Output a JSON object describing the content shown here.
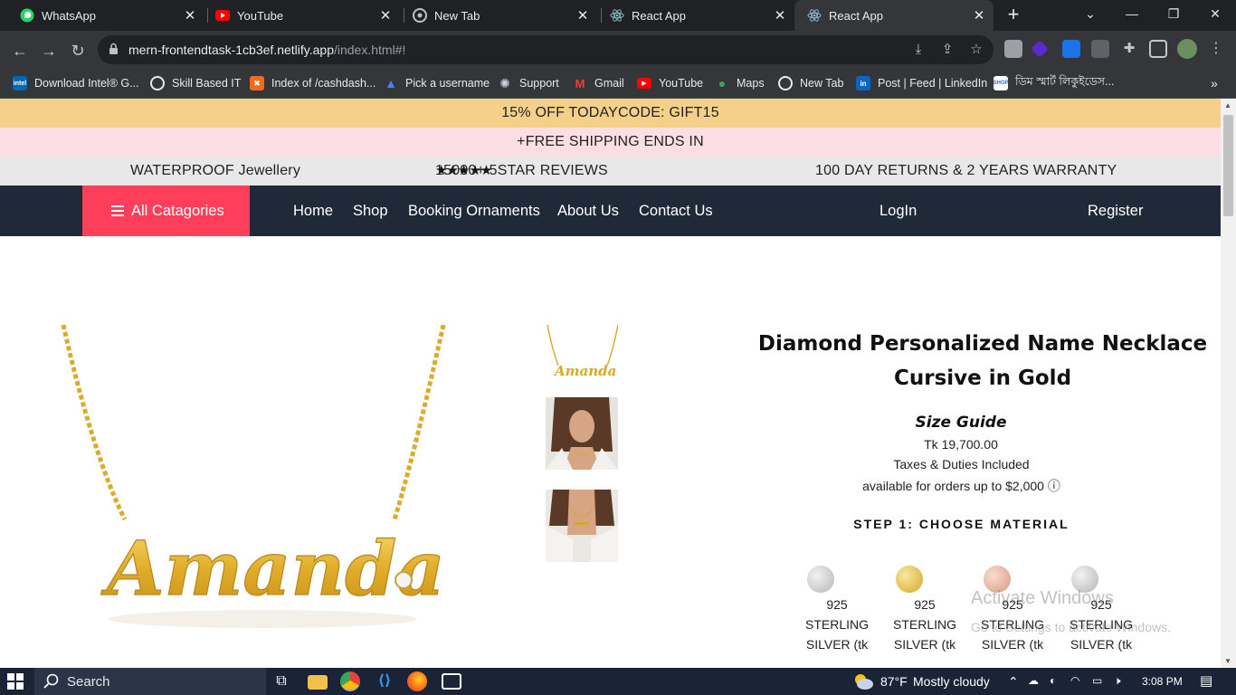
{
  "browser": {
    "tabs": [
      {
        "title": "WhatsApp",
        "icon": "whatsapp-icon"
      },
      {
        "title": "YouTube",
        "icon": "youtube-icon"
      },
      {
        "title": "New Tab",
        "icon": "chrome-icon"
      },
      {
        "title": "React App",
        "icon": "react-icon"
      },
      {
        "title": "React App",
        "icon": "react-icon"
      }
    ],
    "url_host": "mern-frontendtask-1cb3ef.netlify.app",
    "url_path": "/index.html#!",
    "bookmarks": [
      {
        "label": "Download Intel® G...",
        "icon": "intel-icon"
      },
      {
        "label": "Skill Based IT",
        "icon": "globe-icon"
      },
      {
        "label": "Index of /cashdash...",
        "icon": "index-icon"
      },
      {
        "label": "Pick a username",
        "icon": "pick-icon"
      },
      {
        "label": "Support",
        "icon": "support-icon"
      },
      {
        "label": "Gmail",
        "icon": "gmail-icon"
      },
      {
        "label": "YouTube",
        "icon": "youtube-icon"
      },
      {
        "label": "Maps",
        "icon": "maps-icon"
      },
      {
        "label": "New Tab",
        "icon": "globe-icon"
      },
      {
        "label": "Post | Feed | LinkedIn",
        "icon": "linkedin-icon"
      },
      {
        "label": "ডিম স্মার্ট লিকুইডেস...",
        "icon": "shop-icon"
      }
    ]
  },
  "promo": {
    "line1": "15% OFF TODAYCODE: GIFT15",
    "line2": "+FREE SHIPPING ENDS IN",
    "waterproof": "WATERPROOF Jewellery",
    "stars": "★★★★★",
    "reviews": "15000+ 5STAR REVIEWS",
    "returns": "100 DAY RETURNS & 2 YEARS WARRANTY"
  },
  "nav": {
    "all_categories": "All Catagories",
    "links": [
      "Home",
      "Shop",
      "Booking Ornaments",
      "About Us",
      "Contact Us"
    ],
    "login": "LogIn",
    "register": "Register"
  },
  "product": {
    "title": "Diamond Personalized Name Necklace Cursive in Gold",
    "necklace_name": "Amanda",
    "size_guide": "Size Guide",
    "price": "Tk 19,700.00",
    "taxes": "Taxes & Duties Included",
    "availability": "available for orders up to $2,000 ⓘ",
    "step1": "STEP 1: CHOOSE MATERIAL",
    "materials": [
      {
        "label": "925 STERLING SILVER (tk",
        "color": "#c8c8c8"
      },
      {
        "label": "925 STERLING SILVER (tk",
        "color": "#e3c04d"
      },
      {
        "label": "925 STERLING SILVER (tk",
        "color": "#e9b39d"
      },
      {
        "label": "925 STERLING SILVER (tk",
        "color": "#c8c8c8"
      }
    ]
  },
  "watermark": {
    "title": "Activate Windows",
    "subtitle": "Go to Settings to activate Windows."
  },
  "taskbar": {
    "search": "Search",
    "weather_temp": "87°F",
    "weather_text": "Mostly cloudy",
    "time": "3:08 PM"
  },
  "colors": {
    "accent": "#ff3e5b",
    "nav_bg": "#202938",
    "promo_yellow": "#f4d08a",
    "promo_pink": "#fbdfe4",
    "gold": "#e3b332"
  }
}
